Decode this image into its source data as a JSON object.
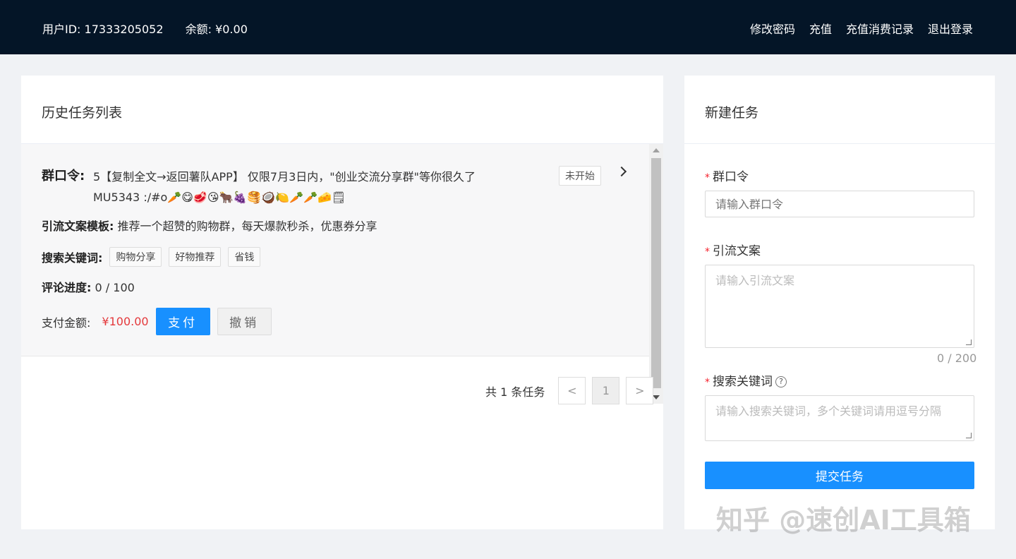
{
  "header": {
    "user_id": "用户ID: 17333205052",
    "balance": "余额: ¥0.00",
    "nav": [
      "修改密码",
      "充值",
      "充值消费记录",
      "退出登录"
    ]
  },
  "history": {
    "title": "历史任务列表",
    "task": {
      "code_label": "群口令",
      "code_text_line1": "5【复制全文→返回薯队APP】 仅限7月3日内，\"创业交流分享群\"等你很久了",
      "code_text_line2": "MU5343 :/#o🥕😋🥩😘🐂🍇🥞🥥🍋🥕🥕🧀🗒",
      "status": "未开始",
      "template_label": "引流文案模板",
      "template_text": "推荐一个超赞的购物群，每天爆款秒杀，优惠券分享",
      "keywords_label": "搜索关键词",
      "keywords": [
        "购物分享",
        "好物推荐",
        "省钱"
      ],
      "progress_label": "评论进度",
      "progress_text": "0 / 100",
      "pay_label": "支付金额:",
      "pay_amount": "¥100.00",
      "pay_button": "支付",
      "cancel_button": "撤销"
    },
    "pagination": {
      "total": "共 1 条任务",
      "prev": "<",
      "page": "1",
      "next": ">"
    }
  },
  "new_task": {
    "title": "新建任务",
    "code_label": "群口令",
    "code_placeholder": "请输入群口令",
    "copy_label": "引流文案",
    "copy_placeholder": "请输入引流文案",
    "copy_counter": "0 / 200",
    "keywords_label": "搜索关键词",
    "keywords_help": "?",
    "keywords_placeholder": "请输入搜索关键词，多个关键词请用逗号分隔",
    "submit_button": "提交任务"
  },
  "watermark": "知乎 @速创AI工具箱",
  "colors": {
    "header_bg": "#041527",
    "primary": "#1890ff",
    "price": "#e4393c",
    "required": "#f5222d"
  }
}
